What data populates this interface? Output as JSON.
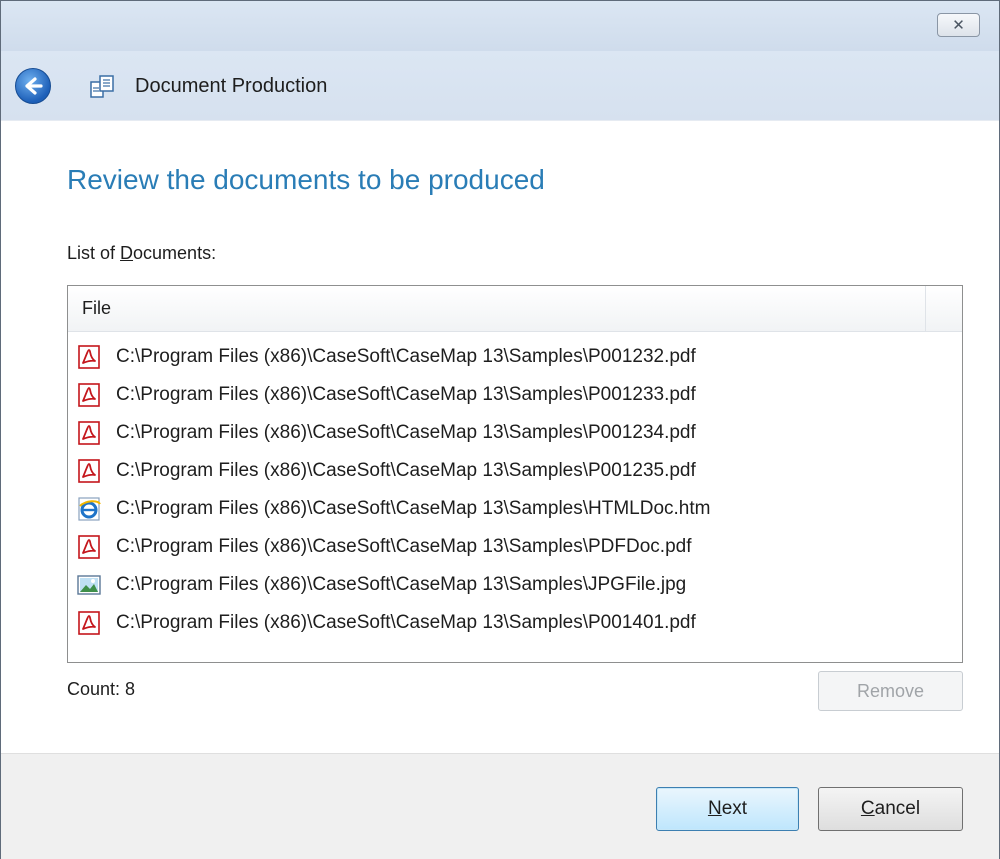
{
  "window": {
    "close_glyph": "✕",
    "title": "Document Production",
    "back_icon": "back-arrow-icon",
    "app_icon": "document-production-icon"
  },
  "page": {
    "heading": "Review the documents to be produced",
    "list_label_prefix": "List of ",
    "list_label_mnemonic": "D",
    "list_label_rest": "ocuments:"
  },
  "list": {
    "column_header": "File",
    "rows": [
      {
        "icon": "pdf-icon",
        "path": "C:\\Program Files (x86)\\CaseSoft\\CaseMap 13\\Samples\\P001232.pdf"
      },
      {
        "icon": "pdf-icon",
        "path": "C:\\Program Files (x86)\\CaseSoft\\CaseMap 13\\Samples\\P001233.pdf"
      },
      {
        "icon": "pdf-icon",
        "path": "C:\\Program Files (x86)\\CaseSoft\\CaseMap 13\\Samples\\P001234.pdf"
      },
      {
        "icon": "pdf-icon",
        "path": "C:\\Program Files (x86)\\CaseSoft\\CaseMap 13\\Samples\\P001235.pdf"
      },
      {
        "icon": "html-document-icon",
        "path": "C:\\Program Files (x86)\\CaseSoft\\CaseMap 13\\Samples\\HTMLDoc.htm"
      },
      {
        "icon": "pdf-icon",
        "path": "C:\\Program Files (x86)\\CaseSoft\\CaseMap 13\\Samples\\PDFDoc.pdf"
      },
      {
        "icon": "image-file-icon",
        "path": "C:\\Program Files (x86)\\CaseSoft\\CaseMap 13\\Samples\\JPGFile.jpg"
      },
      {
        "icon": "pdf-icon",
        "path": "C:\\Program Files (x86)\\CaseSoft\\CaseMap 13\\Samples\\P001401.pdf"
      }
    ]
  },
  "status": {
    "count_label": "Count: 8",
    "remove_label": "Remove"
  },
  "footer": {
    "next_mnemonic": "N",
    "next_rest": "ext",
    "cancel_mnemonic": "C",
    "cancel_rest": "ancel"
  },
  "colors": {
    "heading": "#2a7db6",
    "titlebar": "#dbe6f3",
    "footer": "#f0f0f0",
    "pdf_red": "#c4161c"
  }
}
